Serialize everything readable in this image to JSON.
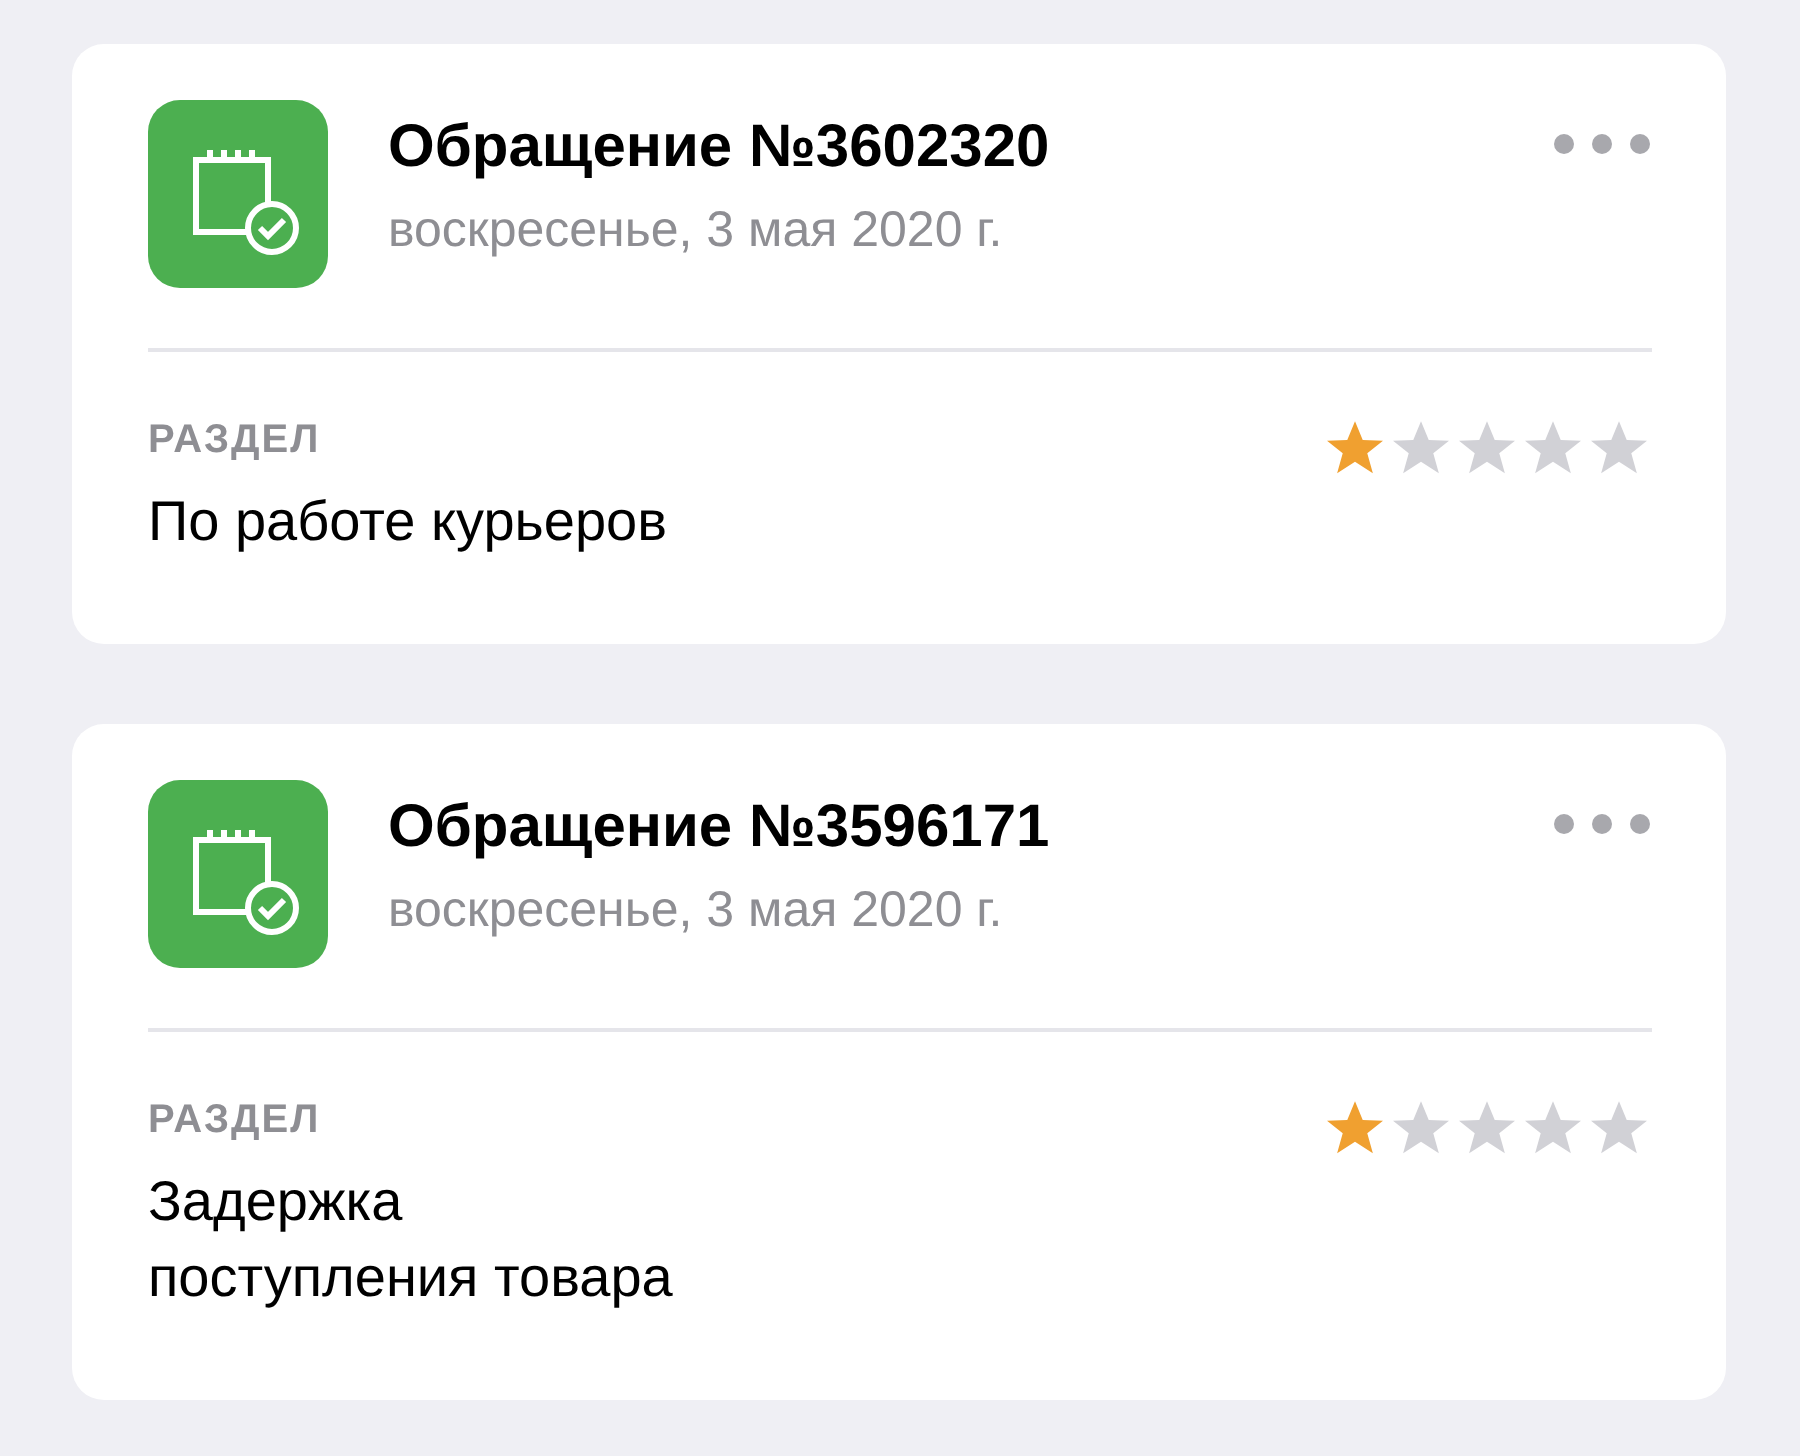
{
  "tickets": [
    {
      "title": "Обращение №3602320",
      "date": "воскресенье, 3 мая 2020 г.",
      "section_label": "РАЗДЕЛ",
      "section": "По работе курьеров",
      "stars": 1
    },
    {
      "title": "Обращение №3596171",
      "date": "воскресенье, 3 мая 2020 г.",
      "section_label": "РАЗДЕЛ",
      "section": "Задержка\nпоступления товара",
      "stars": 1
    }
  ]
}
